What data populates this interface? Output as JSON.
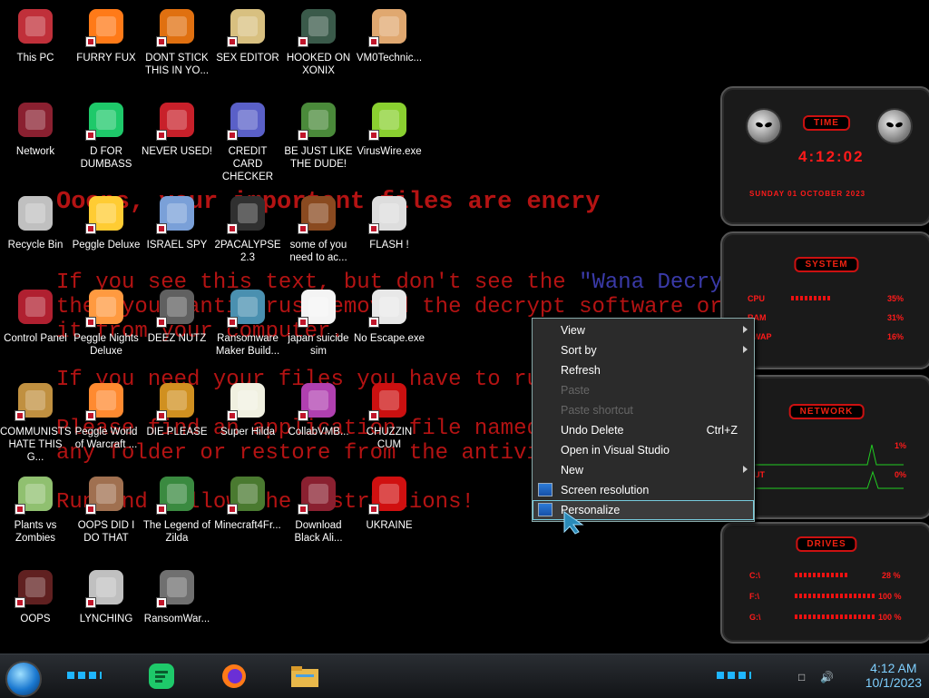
{
  "wallpaper": {
    "line1": "Ooops, your important files are encry",
    "line2a": "If you see this text, but don't see the ",
    "line2b": "\"Wana Decryp",
    "line3": "then your antivirus removed the decrypt software or",
    "line4": "it from your computer.",
    "line5": "If you need your files you have to run",
    "line6": "Please find an application file named",
    "line7": "any folder or restore from the antivi",
    "line8": "Run and follow the instructions!"
  },
  "desktop_icons": [
    {
      "label": "This PC",
      "icon": "computer-icon"
    },
    {
      "label": "FURRY FUX",
      "icon": "firefox-icon"
    },
    {
      "label": "DONT STICK THIS IN YO...",
      "icon": "vlc-cone-icon"
    },
    {
      "label": "SEX EDITOR",
      "icon": "hex-editor-icon"
    },
    {
      "label": "HOOKED ON XONIX",
      "icon": "xonix-game-icon"
    },
    {
      "label": "VM0Technic...",
      "icon": "technician-icon"
    },
    {
      "label": "Network",
      "icon": "network-alien-icon"
    },
    {
      "label": "D FOR DUMBASS",
      "icon": "green-chat-icon"
    },
    {
      "label": "NEVER USED!",
      "icon": "dev-cpp-icon"
    },
    {
      "label": "CREDIT CARD CHECKER",
      "icon": "credit-card-icon"
    },
    {
      "label": "BE JUST LIKE THE DUDE!",
      "icon": "elf-face-icon"
    },
    {
      "label": "VirusWire.exe",
      "icon": "lime-icon"
    },
    {
      "label": "Recycle Bin",
      "icon": "recycle-bin-icon"
    },
    {
      "label": "Peggle Deluxe",
      "icon": "peggle-icon"
    },
    {
      "label": "ISRAEL SPY",
      "icon": "spy-icon"
    },
    {
      "label": "2PACALYPSE 2.3",
      "icon": "terminal-icon"
    },
    {
      "label": "some of you need to ac...",
      "icon": "dog-icon"
    },
    {
      "label": "FLASH !",
      "icon": "flash-icon"
    },
    {
      "label": "Control Panel",
      "icon": "control-panel-icon"
    },
    {
      "label": "Peggle Nights Deluxe",
      "icon": "peggle-nights-icon"
    },
    {
      "label": "DEEZ NUTZ",
      "icon": "stacked-windows-icon"
    },
    {
      "label": "Ransomware Maker Build...",
      "icon": "ransomware-maker-icon"
    },
    {
      "label": "japan suicide sim",
      "icon": "document-icon"
    },
    {
      "label": "No Escape.exe",
      "icon": "no-escape-icon"
    },
    {
      "label": "COMMUNISTS HATE THIS G...",
      "icon": "money-bag-icon"
    },
    {
      "label": "Peggle World of Warcraft ...",
      "icon": "peggle-wow-icon"
    },
    {
      "label": "DIE PLEASE",
      "icon": "de-icon"
    },
    {
      "label": "Super Hilda",
      "icon": "pixel-dog-icon"
    },
    {
      "label": "CollabVMB...",
      "icon": "collabvm-icon"
    },
    {
      "label": "CHUZZIN CUM",
      "icon": "chuzzle-icon"
    },
    {
      "label": "Plants vs Zombies",
      "icon": "pvz-icon"
    },
    {
      "label": "OOPS DID I DO THAT",
      "icon": "portrait-icon"
    },
    {
      "label": "The Legend of Zilda",
      "icon": "zelda-icon"
    },
    {
      "label": "Minecraft4Fr...",
      "icon": "minecraft-icon"
    },
    {
      "label": "Download Black Ali...",
      "icon": "alien-download-icon"
    },
    {
      "label": "UKRAINE",
      "icon": "radiation-icon"
    },
    {
      "label": "OOPS",
      "icon": "oops-icon"
    },
    {
      "label": "LYNCHING",
      "icon": "lynching-icon"
    },
    {
      "label": "RansomWar...",
      "icon": "skull-icon"
    }
  ],
  "context_menu": {
    "items": [
      {
        "label": "View",
        "shortcut": "",
        "submenu": true,
        "disabled": false
      },
      {
        "label": "Sort by",
        "shortcut": "",
        "submenu": true,
        "disabled": false
      },
      {
        "label": "Refresh",
        "shortcut": "",
        "submenu": false,
        "disabled": false
      },
      {
        "label": "Paste",
        "shortcut": "",
        "submenu": false,
        "disabled": true
      },
      {
        "label": "Paste shortcut",
        "shortcut": "",
        "submenu": false,
        "disabled": true
      },
      {
        "label": "Undo Delete",
        "shortcut": "Ctrl+Z",
        "submenu": false,
        "disabled": false
      },
      {
        "label": "Open in Visual Studio",
        "shortcut": "",
        "submenu": false,
        "disabled": false
      },
      {
        "label": "New",
        "shortcut": "",
        "submenu": true,
        "disabled": false
      },
      {
        "label": "Screen resolution",
        "shortcut": "",
        "submenu": false,
        "disabled": false
      },
      {
        "label": "Personalize",
        "shortcut": "",
        "submenu": false,
        "disabled": false
      }
    ]
  },
  "gadgets": {
    "time": {
      "title": "TIME",
      "clock": "4:12:02",
      "date": "SUNDAY 01 OCTOBER 2023"
    },
    "system": {
      "title": "SYSTEM",
      "cpu_label": "CPU",
      "cpu_value": "35%",
      "ram_label": "RAM",
      "ram_value": "31%",
      "swap_label": "SWAP",
      "swap_value": "16%"
    },
    "network": {
      "title": "NETWORK",
      "in_value": "1%",
      "out_label": "OUT",
      "out_value": "0%"
    },
    "drives": {
      "title": "DRIVES",
      "c_label": "C:\\",
      "c_value": "28 %",
      "f_label": "F:\\",
      "f_value": "100 %",
      "g_label": "G:\\",
      "g_value": "100 %"
    }
  },
  "taskbar": {
    "time": "4:12 AM",
    "date": "10/1/2023",
    "pinned": [
      "green-chat-icon",
      "firefox-icon",
      "file-explorer-icon"
    ]
  },
  "colors": {
    "accent": "#1fb6ff",
    "ransom_red": "#b41313",
    "gadget_red": "#ff1a1a"
  }
}
